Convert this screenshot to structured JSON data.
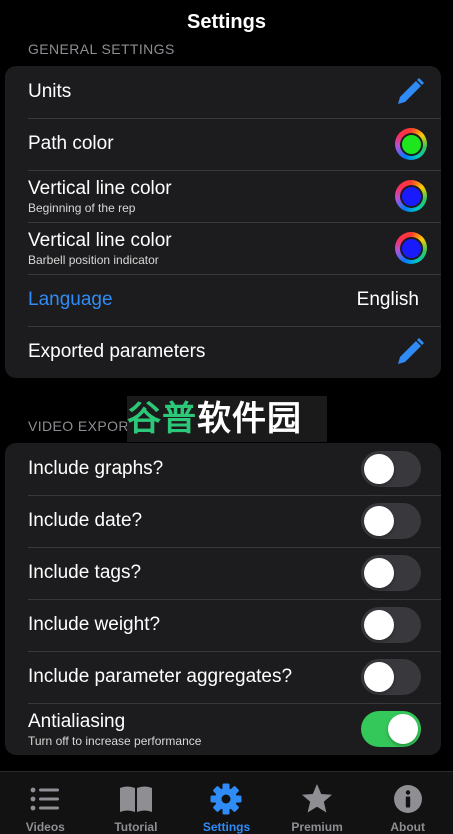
{
  "navbar": {
    "title": "Settings"
  },
  "general": {
    "header": "GENERAL SETTINGS",
    "rows": [
      {
        "label": "Units"
      },
      {
        "label": "Path color",
        "color": "#1ee61e"
      },
      {
        "label": "Vertical line color",
        "sublabel": "Beginning of the rep",
        "color": "#1a1aff"
      },
      {
        "label": "Vertical line color",
        "sublabel": "Barbell position indicator",
        "color": "#1a1aff"
      },
      {
        "label": "Language",
        "value": "English"
      },
      {
        "label": "Exported parameters"
      }
    ]
  },
  "video_export": {
    "header": "VIDEO EXPORT",
    "rows": [
      {
        "label": "Include graphs?",
        "on": false
      },
      {
        "label": "Include date?",
        "on": false
      },
      {
        "label": "Include tags?",
        "on": false
      },
      {
        "label": "Include weight?",
        "on": false
      },
      {
        "label": "Include parameter aggregates?",
        "on": false
      },
      {
        "label": "Antialiasing",
        "sublabel": "Turn off to increase performance",
        "on": true
      }
    ]
  },
  "watermark": {
    "part1": "谷普",
    "part2": "软件园"
  },
  "tabbar": {
    "tabs": [
      {
        "label": "Videos",
        "icon": "list-icon"
      },
      {
        "label": "Tutorial",
        "icon": "book-icon"
      },
      {
        "label": "Settings",
        "icon": "gear-icon",
        "active": true
      },
      {
        "label": "Premium",
        "icon": "star-icon"
      },
      {
        "label": "About",
        "icon": "info-icon"
      }
    ]
  },
  "colors": {
    "accent": "#2f8cf7",
    "toggle_on": "#34c759",
    "group_bg": "#1c1c1e",
    "tab_inactive": "#8e8e93"
  }
}
